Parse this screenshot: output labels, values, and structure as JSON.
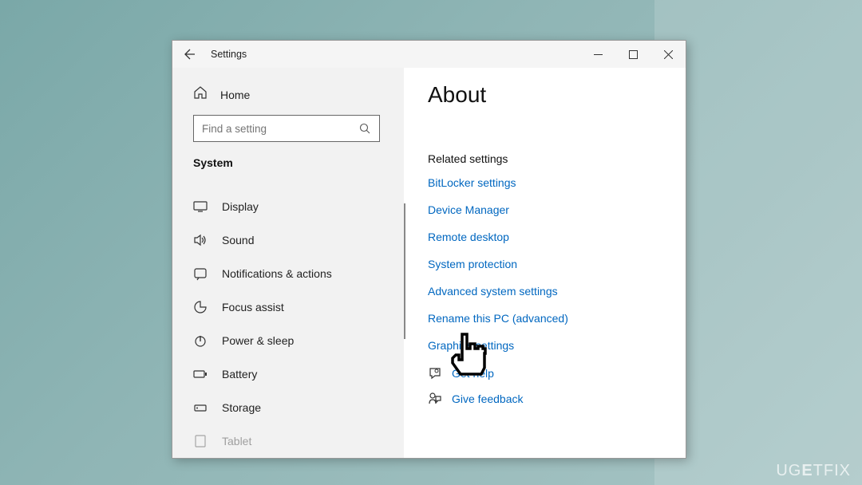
{
  "window": {
    "title": "Settings",
    "home": "Home",
    "search_placeholder": "Find a setting",
    "category": "System"
  },
  "sidebar": {
    "items": [
      {
        "label": "Display"
      },
      {
        "label": "Sound"
      },
      {
        "label": "Notifications & actions"
      },
      {
        "label": "Focus assist"
      },
      {
        "label": "Power & sleep"
      },
      {
        "label": "Battery"
      },
      {
        "label": "Storage"
      },
      {
        "label": "Tablet"
      }
    ]
  },
  "content": {
    "title": "About",
    "related_label": "Related settings",
    "links": [
      "BitLocker settings",
      "Device Manager",
      "Remote desktop",
      "System protection",
      "Advanced system settings",
      "Rename this PC (advanced)",
      "Graphics settings"
    ],
    "help": "Get help",
    "feedback": "Give feedback"
  },
  "watermark": "UGETFIX"
}
